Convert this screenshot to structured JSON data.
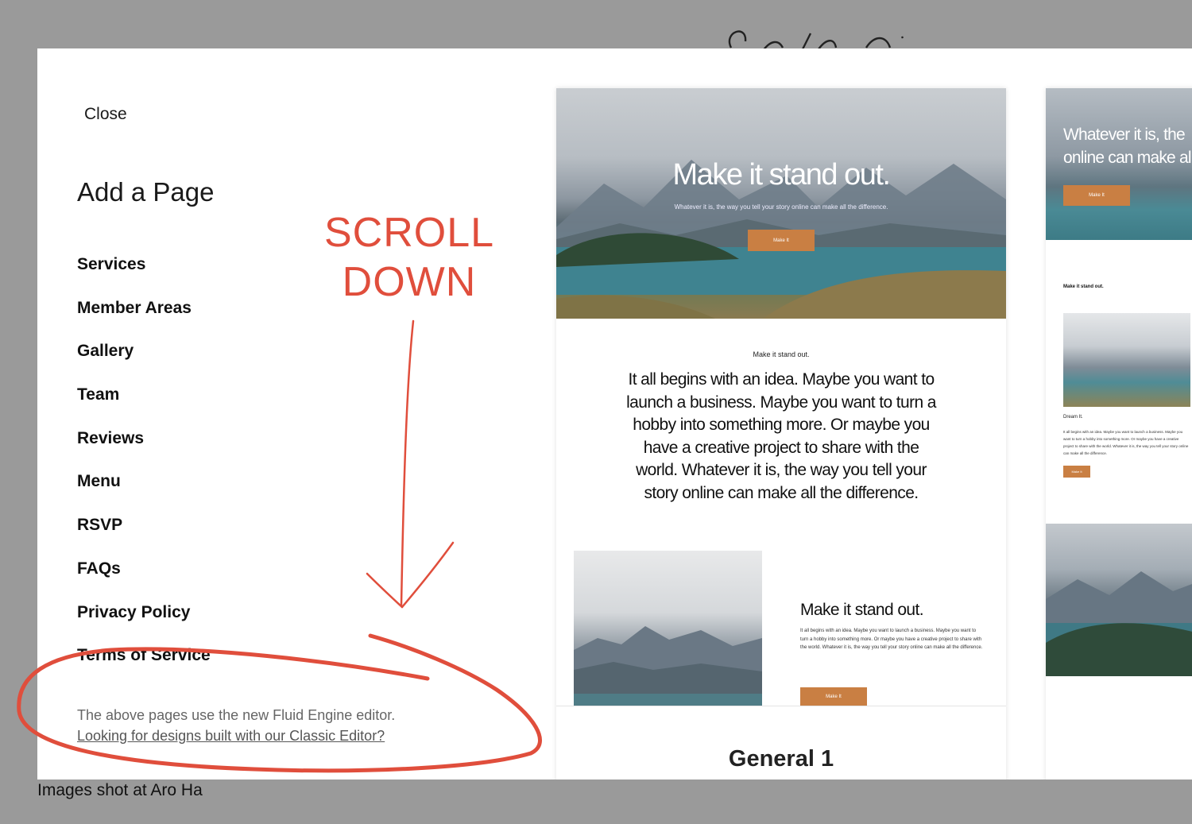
{
  "panel": {
    "close_label": "Close",
    "title": "Add a Page",
    "pages": [
      "Services",
      "Member Areas",
      "Gallery",
      "Team",
      "Reviews",
      "Menu",
      "RSVP",
      "FAQs",
      "Privacy Policy",
      "Terms of Service"
    ],
    "note": "The above pages use the new Fluid Engine editor.",
    "classic_link": "Looking for designs built with our Classic Editor?"
  },
  "preview_main": {
    "hero_title": "Make it stand out.",
    "hero_subtitle": "Whatever it is, the way you tell your story online can make all the difference.",
    "hero_button": "Make It",
    "section_kicker": "Make it stand out.",
    "section_body": "It all begins with an idea. Maybe you want to launch a business. Maybe you want to turn a hobby into something more. Or maybe you have a creative project to share with the world. Whatever it is, the way you tell your story online can make all the difference.",
    "split_title": "Make it stand out.",
    "split_body": "It all begins with an idea. Maybe you want to launch a business. Maybe you want to turn a hobby into something more. Or maybe you have a creative project to share with the world. Whatever it is, the way you tell your story online can make all the difference.",
    "split_button": "Make It",
    "template_name": "General 1"
  },
  "preview_side": {
    "hero_line1": "Whatever it is, the",
    "hero_line2": "online can make al",
    "hero_button": "Make It",
    "kicker": "Make it stand out.",
    "caption": "Dream It.",
    "body": "It all begins with an idea. Maybe you want to launch a business. Maybe you want to turn a hobby into something more. Or maybe you have a creative project to share with the world. Whatever it is, the way you tell your story online can make all the difference.",
    "button": "Make It"
  },
  "annotation": {
    "line1": "SCROLL",
    "line2": "DOWN",
    "color": "#e04e3c"
  },
  "caption": "Images shot at Aro Ha",
  "colors": {
    "accent_button": "#c97f43",
    "backdrop": "#9a9a9a"
  }
}
